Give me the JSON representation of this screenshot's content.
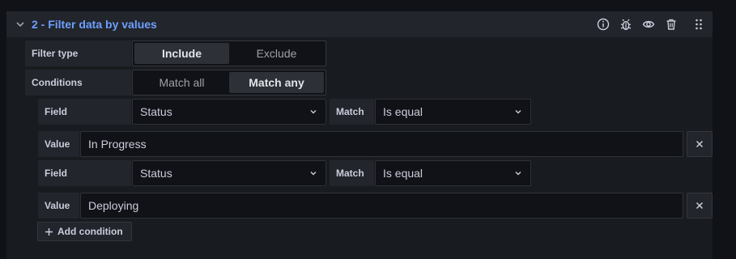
{
  "header": {
    "title": "2 - Filter data by values",
    "icons": [
      "chevron-down-icon",
      "info-icon",
      "bug-icon",
      "eye-icon",
      "trash-icon",
      "drag-handle-icon"
    ]
  },
  "filter_type": {
    "label": "Filter type",
    "options": [
      "Include",
      "Exclude"
    ],
    "selected": "Include"
  },
  "conditions": {
    "label": "Conditions",
    "options": [
      "Match all",
      "Match any"
    ],
    "selected": "Match any"
  },
  "condition_rows": [
    {
      "field_label": "Field",
      "field_value": "Status",
      "match_label": "Match",
      "match_value": "Is equal",
      "value_label": "Value",
      "value": "In Progress"
    },
    {
      "field_label": "Field",
      "field_value": "Status",
      "match_label": "Match",
      "match_value": "Is equal",
      "value_label": "Value",
      "value": "Deploying"
    }
  ],
  "add_condition": {
    "label": "Add condition",
    "icon": "plus-icon"
  },
  "colors": {
    "background": "#111217",
    "panel": "#181b1f",
    "accent": "#6e9fff",
    "text": "#ccccdc"
  }
}
